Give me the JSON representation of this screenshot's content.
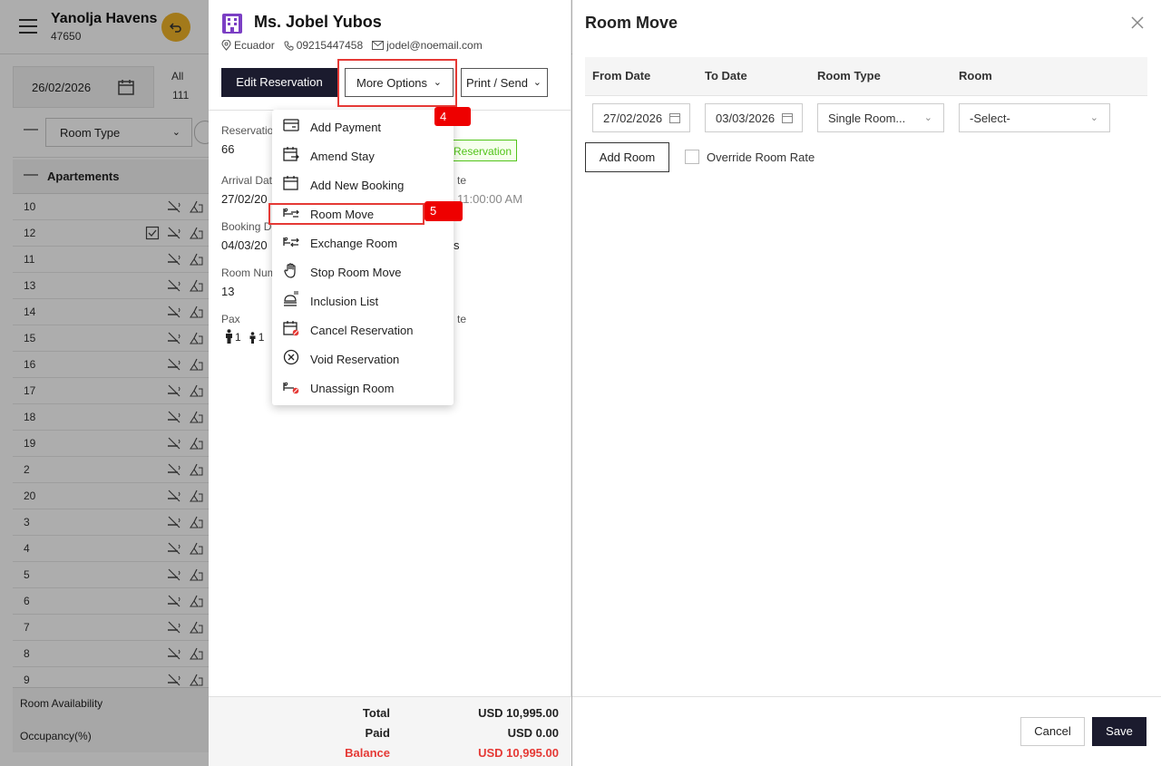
{
  "background": {
    "hotel_name": "Yanolja Havens",
    "hotel_code": "47650",
    "date": "26/02/2026",
    "all_label": "All",
    "all_count": "111",
    "room_type_label": "Room Type",
    "group_name": "Apartements",
    "rooms": [
      {
        "number": "10",
        "checked": false
      },
      {
        "number": "12",
        "checked": true
      },
      {
        "number": "11",
        "checked": false
      },
      {
        "number": "13",
        "checked": false
      },
      {
        "number": "14",
        "checked": false
      },
      {
        "number": "15",
        "checked": false
      },
      {
        "number": "16",
        "checked": false
      },
      {
        "number": "17",
        "checked": false
      },
      {
        "number": "18",
        "checked": false
      },
      {
        "number": "19",
        "checked": false
      },
      {
        "number": "2",
        "checked": false
      },
      {
        "number": "20",
        "checked": false
      },
      {
        "number": "3",
        "checked": false
      },
      {
        "number": "4",
        "checked": false
      },
      {
        "number": "5",
        "checked": false
      },
      {
        "number": "6",
        "checked": false
      },
      {
        "number": "7",
        "checked": false
      },
      {
        "number": "8",
        "checked": false
      },
      {
        "number": "9",
        "checked": false
      }
    ],
    "room_availability": "Room Availability",
    "occupancy": "Occupancy(%)"
  },
  "reservation": {
    "guest_name": "Ms. Jobel Yubos",
    "country": "Ecuador",
    "phone": "09215447458",
    "email": "jodel@noemail.com",
    "edit_button": "Edit Reservation",
    "more_options_button": "More Options",
    "print_button": "Print / Send",
    "reservation_label": "Reservatio",
    "reservation_value": "66",
    "status_chip": "Reservation",
    "arrival_label": "Arrival Dat",
    "arrival_value": "27/02/20",
    "time_label_fragment": "te",
    "time_value": "11:00:00 AM",
    "booking_label": "Booking D",
    "booking_value": "04/03/20",
    "booking_suffix": "s",
    "room_num_label": "Room Num",
    "room_num_value": "13",
    "pax_label": "Pax",
    "pax_adults": "1",
    "pax_children": "1",
    "pax_right_fragment": "te",
    "footer": {
      "total_label": "Total",
      "total_value": "USD 10,995.00",
      "paid_label": "Paid",
      "paid_value": "USD 0.00",
      "balance_label": "Balance",
      "balance_value": "USD 10,995.00",
      "balance_color": "#e53935"
    }
  },
  "menu": {
    "items": [
      {
        "label": "Add Payment",
        "icon": "payment-card-icon"
      },
      {
        "label": "Amend Stay",
        "icon": "amend-calendar-icon"
      },
      {
        "label": "Add New Booking",
        "icon": "calendar-icon"
      },
      {
        "label": "Room Move",
        "icon": "room-move-icon"
      },
      {
        "label": "Exchange Room",
        "icon": "exchange-room-icon"
      },
      {
        "label": "Stop Room Move",
        "icon": "hand-stop-icon"
      },
      {
        "label": "Inclusion List",
        "icon": "inclusion-list-icon"
      },
      {
        "label": "Cancel Reservation",
        "icon": "cancel-calendar-icon"
      },
      {
        "label": "Void Reservation",
        "icon": "void-circle-icon"
      },
      {
        "label": "Unassign Room",
        "icon": "unassign-bed-icon"
      }
    ]
  },
  "annotations": {
    "step4": "4",
    "step5": "5",
    "color": "#e00000"
  },
  "room_move": {
    "title": "Room Move",
    "columns": {
      "from_date": "From Date",
      "to_date": "To Date",
      "room_type": "Room Type",
      "room": "Room"
    },
    "from_date_value": "27/02/2026",
    "to_date_value": "03/03/2026",
    "room_type_value": "Single Room...",
    "room_value": "-Select-",
    "add_room_button": "Add Room",
    "override_label": "Override Room Rate",
    "cancel_button": "Cancel",
    "save_button": "Save"
  },
  "colors": {
    "primary_dark": "#1b1b2e",
    "accent_yellow": "#f0b429",
    "status_green": "#52c41a",
    "menu_icon_purple": "#7b3fc4"
  }
}
